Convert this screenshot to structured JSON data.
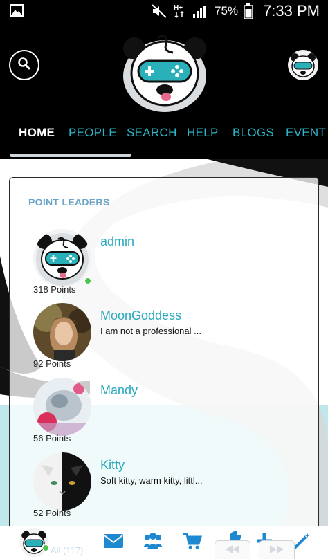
{
  "status_bar": {
    "battery_percent": "75%",
    "time": "7:33 PM",
    "icons": [
      "image-icon",
      "mute-icon",
      "hplus-data-icon",
      "signal-icon",
      "battery-icon"
    ]
  },
  "header": {
    "search_icon": "search-icon",
    "logo": "panda-gamepad-logo",
    "nav": [
      {
        "label": "HOME",
        "active": true
      },
      {
        "label": "PEOPLE",
        "active": false
      },
      {
        "label": "SEARCH",
        "active": false
      },
      {
        "label": "HELP",
        "active": false
      },
      {
        "label": "BLOGS",
        "active": false
      },
      {
        "label": "EVENT",
        "active": false
      }
    ]
  },
  "point_leaders": {
    "title": "POINT LEADERS",
    "leaders": [
      {
        "name": "admin",
        "status": "",
        "points": "318 Points",
        "online": true
      },
      {
        "name": "MoonGoddess",
        "status": "I am not a professional ...",
        "points": "92 Points",
        "online": false
      },
      {
        "name": "Mandy",
        "status": "",
        "points": "56 Points",
        "online": false
      },
      {
        "name": "Kitty",
        "status": "Soft kitty, warm kitty, littl...",
        "points": "52 Points",
        "online": false
      }
    ]
  },
  "bottom_bar": {
    "all_label": "All (117)",
    "icons": [
      "mail-icon",
      "people-icon",
      "cart-icon",
      "wrench-icon",
      "plus-icon",
      "magic-wand-icon",
      "rewind-icon",
      "fast-forward-icon"
    ]
  },
  "colors": {
    "accent": "#2bb5c8",
    "title": "#6aa3c8",
    "online": "#4fc34f",
    "header_bg": "#000000"
  }
}
